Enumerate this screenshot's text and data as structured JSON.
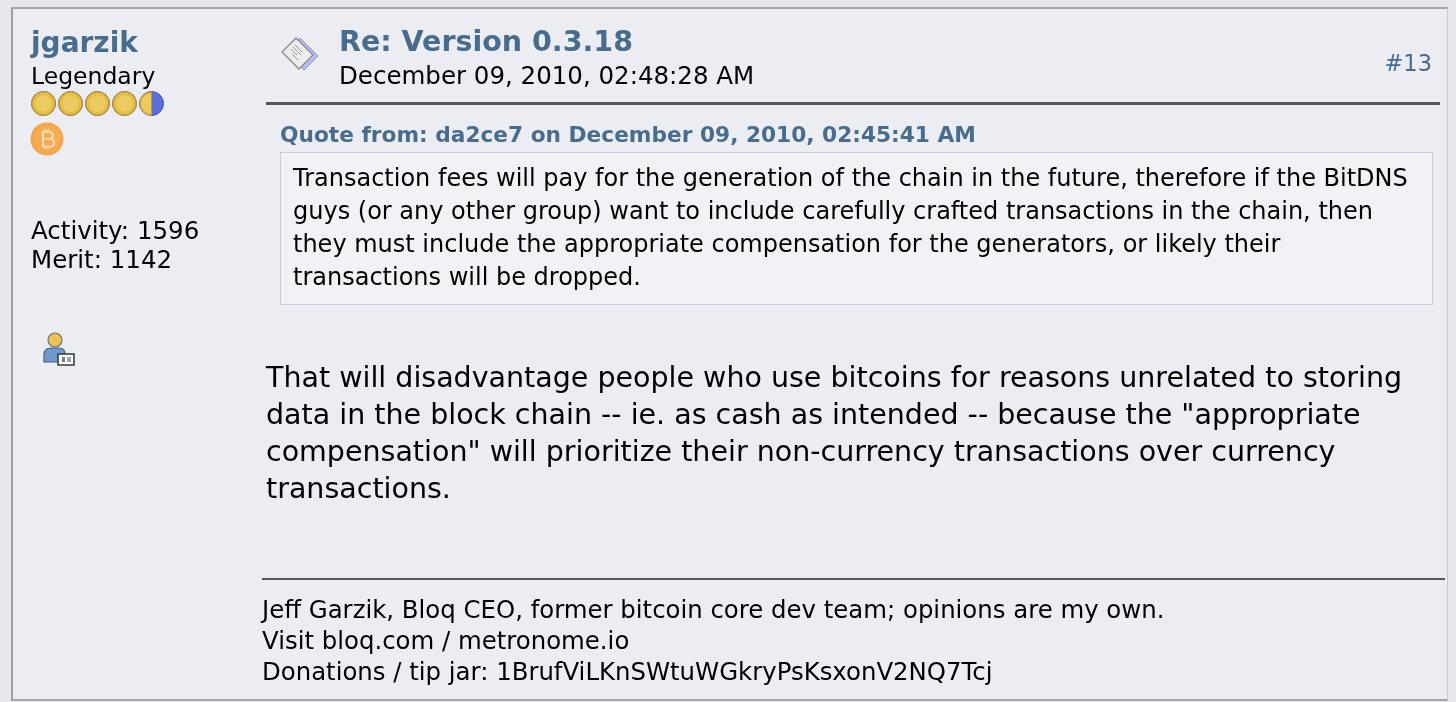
{
  "poster": {
    "name": "jgarzik",
    "rank": "Legendary",
    "stars": 4.5,
    "stats": [
      "Activity: 1596",
      "Merit: 1142"
    ]
  },
  "post": {
    "title": "Re: Version 0.3.18",
    "date": "December 09, 2010, 02:48:28 AM",
    "number": "#13",
    "quote": {
      "header": "Quote from: da2ce7 on December 09, 2010, 02:45:41 AM",
      "text": "Transaction fees will pay for the generation of the chain in the future, therefore if the BitDNS guys (or any other group) want to include carefully crafted transactions in the chain, then they must include the appropriate compensation for the generators, or likely their transactions will be dropped."
    },
    "body": "That will disadvantage people who use bitcoins for reasons unrelated to storing data in the block chain -- ie. as cash as intended -- because the \"appropriate compensation\" will prioritize their non-currency transactions over currency transactions.",
    "signature": [
      "Jeff Garzik, Bloq CEO, former bitcoin core dev team; opinions are my own.",
      "Visit bloq.com / metronome.io",
      "Donations / tip jar: 1BrufViLKnSWtuWGkryPsKsxonV2NQ7Tcj"
    ]
  }
}
